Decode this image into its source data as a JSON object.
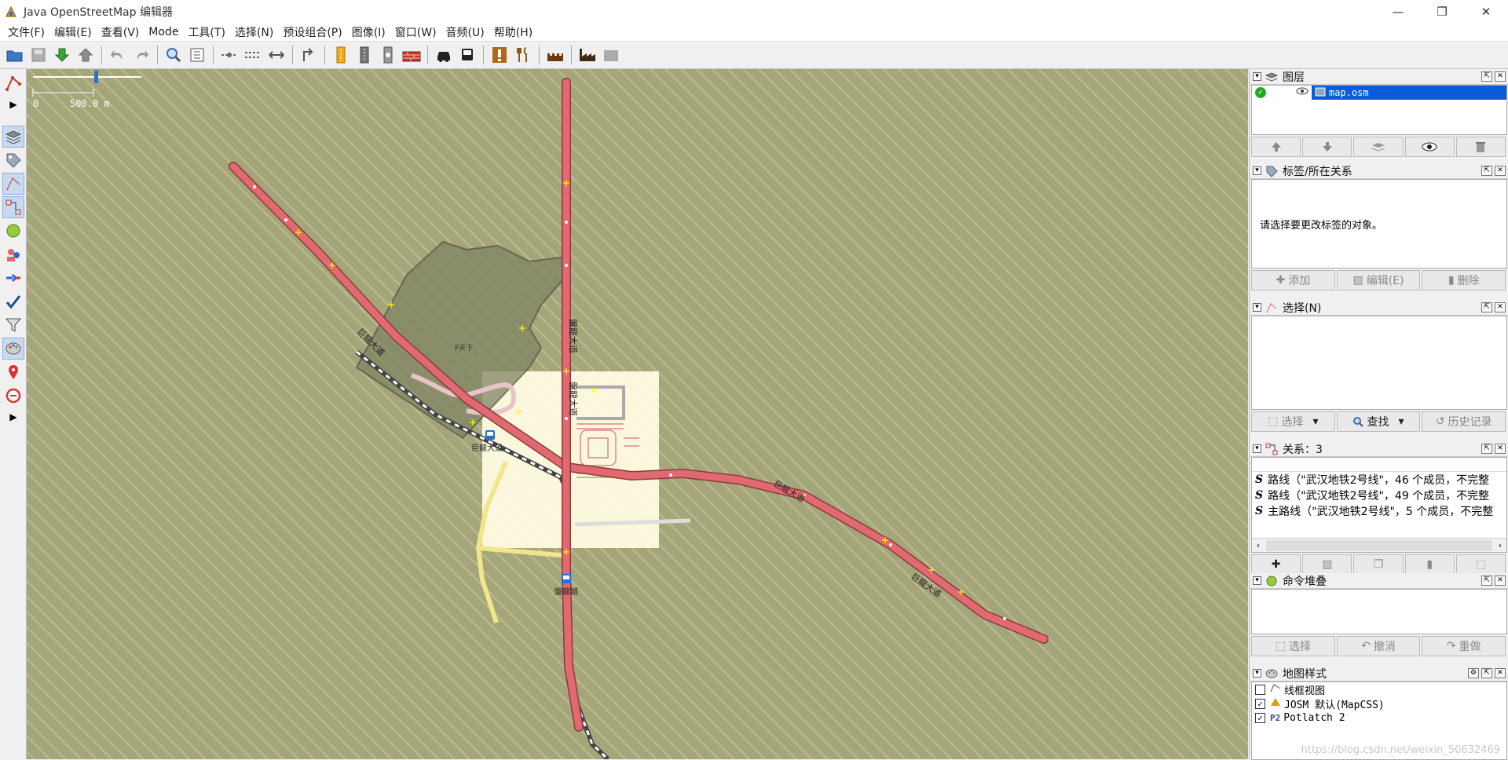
{
  "window": {
    "title": "Java OpenStreetMap 编辑器",
    "minimize": "—",
    "maximize": "❐",
    "close": "✕"
  },
  "menu": [
    "文件(F)",
    "编辑(E)",
    "查看(V)",
    "Mode",
    "工具(T)",
    "选择(N)",
    "预设组合(P)",
    "图像(I)",
    "窗口(W)",
    "音频(U)",
    "帮助(H)"
  ],
  "map": {
    "scale_zero": "0",
    "scale_value": "500.0 m",
    "labels": {
      "road_nw": "巨龍大道",
      "road_n": "盤龍大道",
      "road_n2": "盤龍大道",
      "road_e": "巨龍大道",
      "road_se": "巨龍大道",
      "area": "F天下",
      "stop1": "巨龍大道",
      "stop2": "盤龍城"
    }
  },
  "panels": {
    "layers": {
      "title": "图层",
      "layer_name": "map.osm"
    },
    "tags": {
      "title": "标签/所在关系",
      "empty_message": "请选择要更改标签的对象。",
      "add": "添加",
      "edit": "编辑(E)",
      "delete": "删除"
    },
    "selection": {
      "title": "选择(N)",
      "select": "选择",
      "search": "查找",
      "history": "历史记录"
    },
    "relations": {
      "title": "关系：3",
      "items": [
        "路线（\"武汉地铁2号线\"，46 个成员，不完整",
        "路线（\"武汉地铁2号线\"，49 个成员，不完整",
        "主路线（\"武汉地铁2号线\"，5 个成员，不完整"
      ]
    },
    "command_stack": {
      "title": "命令堆叠",
      "select": "选择",
      "undo": "撤消",
      "redo": "重做"
    },
    "map_styles": {
      "title": "地图样式",
      "items": [
        {
          "label": "线框视图",
          "checked": false
        },
        {
          "label": "JOSM 默认(MapCSS)",
          "checked": true
        },
        {
          "label": "Potlatch 2",
          "checked": true
        }
      ]
    }
  },
  "watermark": "https://blog.csdn.net/weixin_50632469",
  "colors": {
    "road": "#e06a70",
    "map_bg": "#a5a57a",
    "selection": "#0a5bd6"
  }
}
